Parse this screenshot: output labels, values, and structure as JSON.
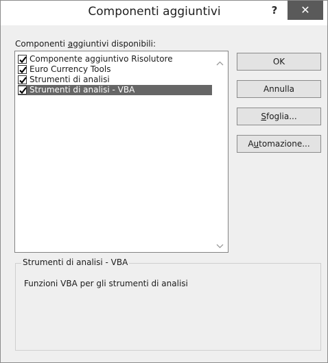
{
  "dialog": {
    "title": "Componenti aggiuntivi",
    "help_label": "?",
    "close_label": "✕"
  },
  "list": {
    "label_before": "Componenti ",
    "label_accel": "a",
    "label_after": "ggiuntivi disponibili:",
    "items": [
      {
        "label": "Componente aggiuntivo Risolutore",
        "checked": true,
        "selected": false
      },
      {
        "label": "Euro Currency Tools",
        "checked": true,
        "selected": false
      },
      {
        "label": "Strumenti di analisi",
        "checked": true,
        "selected": false
      },
      {
        "label": "Strumenti di analisi - VBA",
        "checked": true,
        "selected": true
      }
    ]
  },
  "buttons": {
    "ok": "OK",
    "cancel": "Annulla",
    "browse_accel": "S",
    "browse_rest": "foglia...",
    "automation_before": "A",
    "automation_accel": "u",
    "automation_after": "tomazione..."
  },
  "description": {
    "title": "Strumenti di analisi - VBA",
    "text": "Funzioni VBA per gli strumenti di analisi"
  }
}
